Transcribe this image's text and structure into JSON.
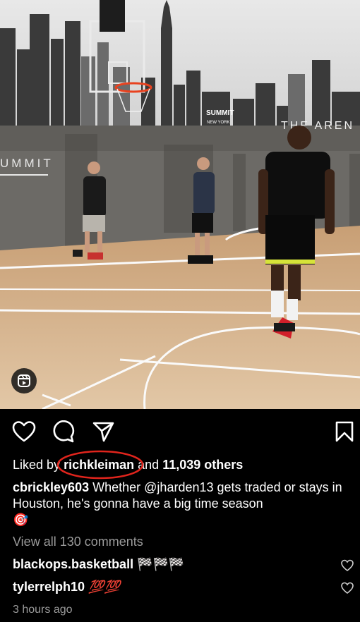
{
  "post": {
    "liked_by_prefix": "Liked by",
    "liked_by_user": "richkleiman",
    "liked_by_joiner": "and",
    "liked_by_others": "11,039 others",
    "caption_user": "cbrickley603",
    "caption_text_1": "Whether",
    "caption_mention": "@jharden13",
    "caption_text_2": "gets traded or stays in Houston, he's gonna have a big time season",
    "caption_emoji": "🎯",
    "view_all_comments": "View all 130 comments",
    "comments": [
      {
        "user": "blackops.basketball",
        "text": "🏁🏁🏁"
      },
      {
        "user": "tylerrelph10",
        "text": "💯💯"
      }
    ],
    "timestamp": "3 hours ago"
  },
  "media": {
    "wall_text_left": "UMMIT",
    "wall_text_right": "THE AREN",
    "banner_text": "SUMMIT",
    "banner_subtext": "NEW YORK"
  },
  "icons": {
    "like": "heart-icon",
    "comment": "comment-icon",
    "share": "send-icon",
    "save": "bookmark-icon",
    "reel": "reel-icon"
  },
  "colors": {
    "background": "#000000",
    "muted_text": "#9b9b9b",
    "annotation_circle": "#e0241c"
  }
}
